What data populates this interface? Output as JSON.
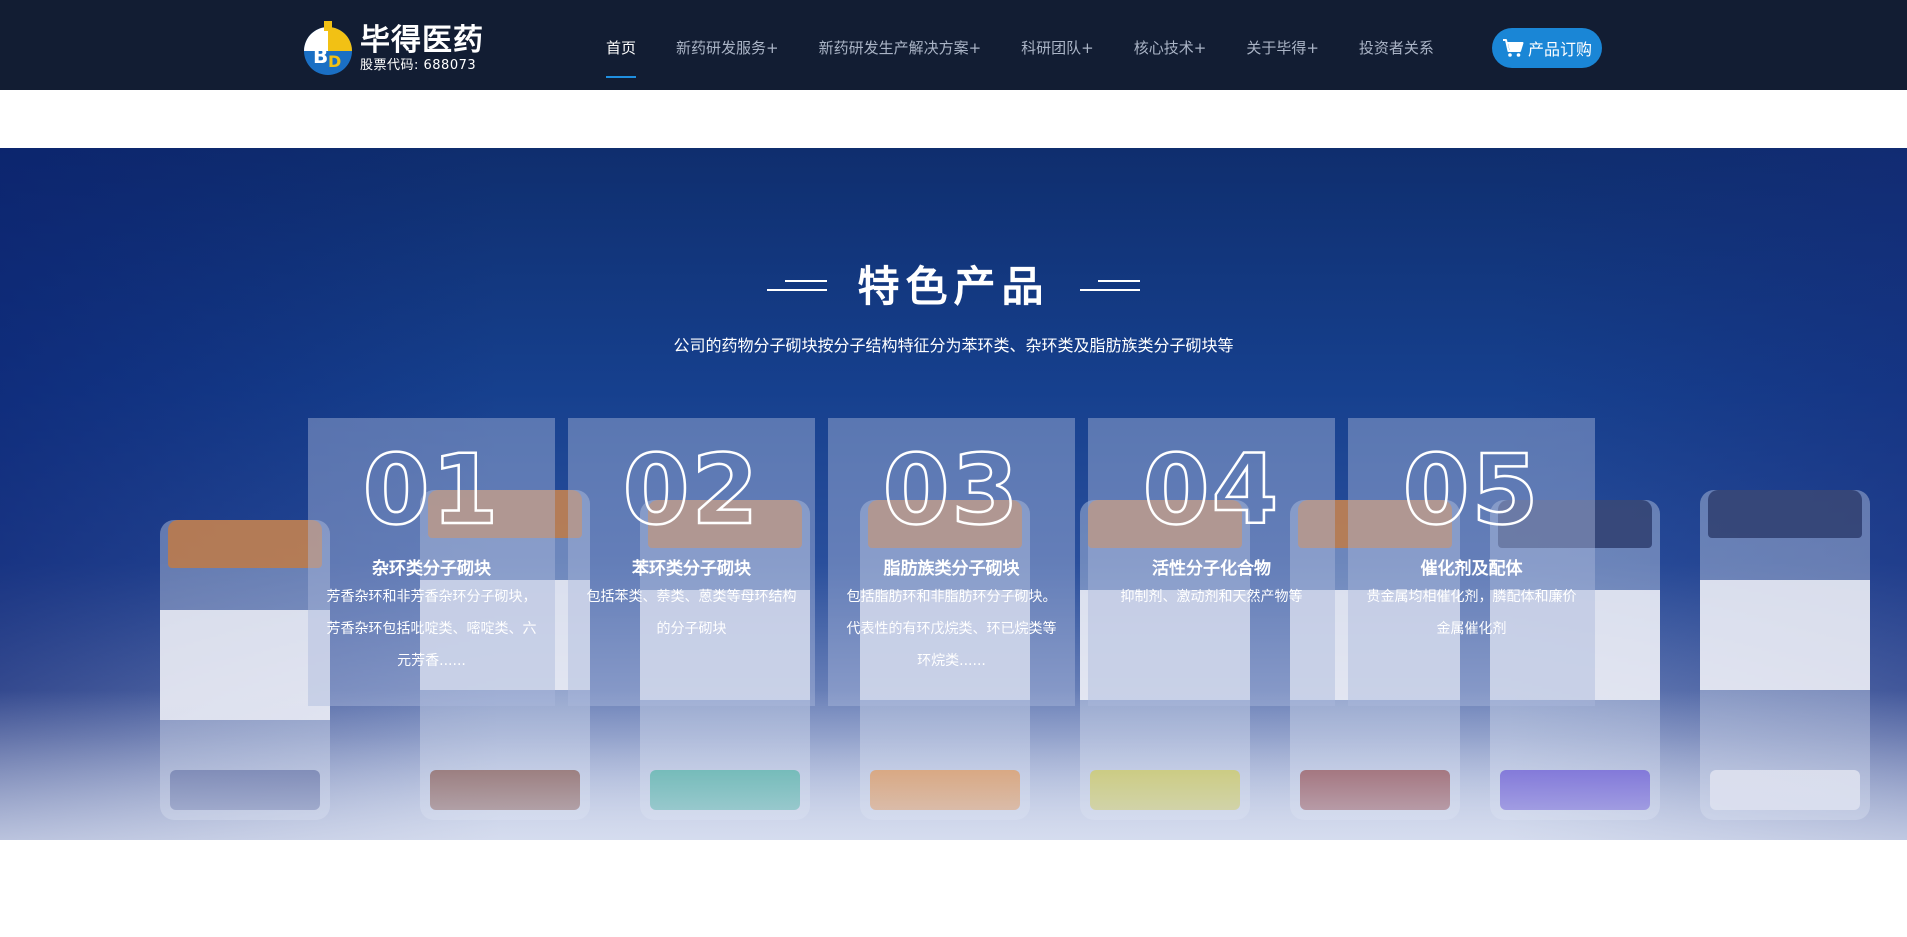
{
  "header": {
    "logo": {
      "name": "毕得医药",
      "stock_code": "股票代码: 688073"
    },
    "nav": [
      {
        "label": "首页",
        "active": true
      },
      {
        "label": "新药研发服务+",
        "active": false
      },
      {
        "label": "新药研发生产解决方案+",
        "active": false
      },
      {
        "label": "科研团队+",
        "active": false
      },
      {
        "label": "核心技术+",
        "active": false
      },
      {
        "label": "关于毕得+",
        "active": false
      },
      {
        "label": "投资者关系",
        "active": false
      }
    ],
    "order_button": {
      "label": "产品订购",
      "icon": "cart-icon"
    }
  },
  "featured": {
    "title": "特色产品",
    "subtitle": "公司的药物分子砌块按分子结构特征分为苯环类、杂环类及脂肪族类分子砌块等",
    "cards": [
      {
        "number": "01",
        "title": "杂环类分子砌块",
        "desc": "芳香杂环和非芳香杂环分子砌块，芳香杂环包括吡啶类、嘧啶类、六元芳香......"
      },
      {
        "number": "02",
        "title": "苯环类分子砌块",
        "desc": "包括苯类、萘类、蒽类等母环结构的分子砌块"
      },
      {
        "number": "03",
        "title": "脂肪族类分子砌块",
        "desc": "包括脂肪环和非脂肪环分子砌块。代表性的有环戊烷类、环已烷类等环烷类......"
      },
      {
        "number": "04",
        "title": "活性分子化合物",
        "desc": "抑制剂、激动剂和天然产物等"
      },
      {
        "number": "05",
        "title": "催化剂及配体",
        "desc": "贵金属均相催化剂，膦配体和廉价金属催化剂"
      }
    ]
  },
  "colors": {
    "header_bg": "#121d33",
    "accent": "#1a86d6",
    "active_underline": "#1f8fe0"
  }
}
